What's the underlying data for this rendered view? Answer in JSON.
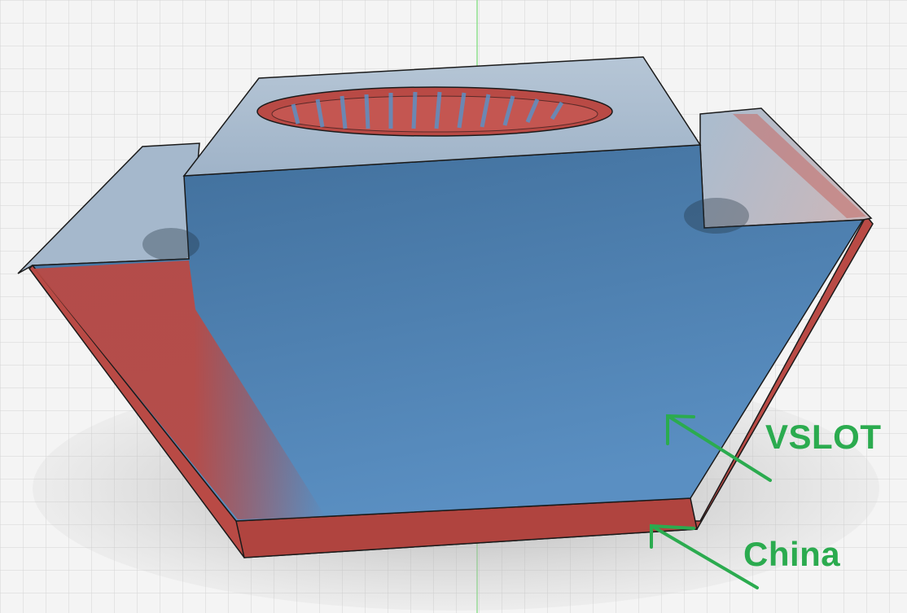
{
  "viewport": {
    "background_color": "#f4f4f4",
    "grid_color": "#d4d4d4",
    "axis_line_color": "#8fe08f"
  },
  "model": {
    "blue_color": "#4f86b8",
    "blue_dark_color": "#3f6f9c",
    "blue_top_color": "#aebfd1",
    "red_color": "#b94a45",
    "red_dark_color": "#9e3b36",
    "outline_color": "#1a1a1a"
  },
  "annotations": {
    "color": "#2bab4f",
    "vslot_label": "VSLOT",
    "china_label": "China"
  }
}
